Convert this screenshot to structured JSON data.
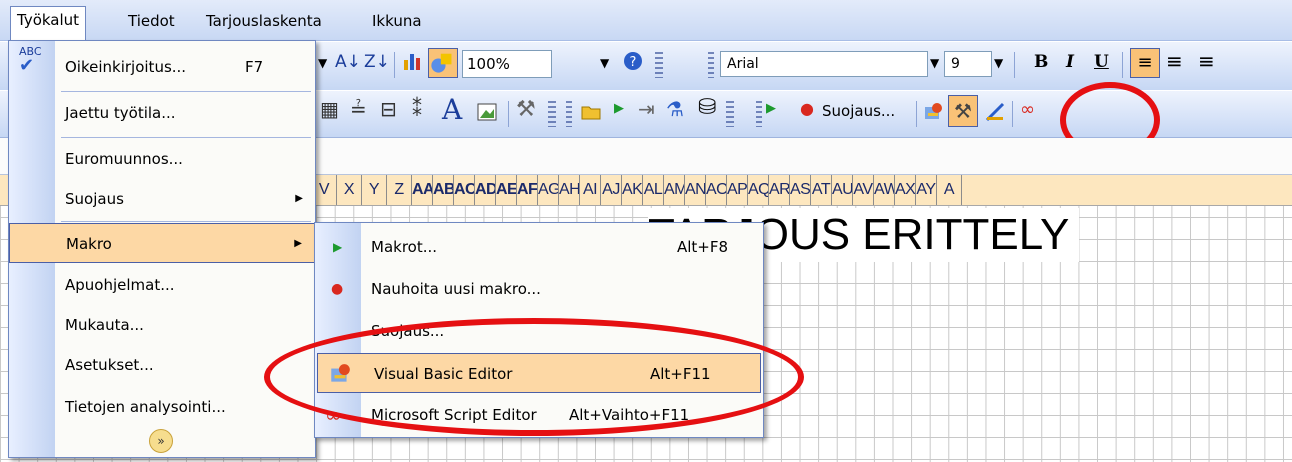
{
  "menubar": {
    "items": [
      {
        "label": "Työkalut"
      },
      {
        "label": "Tiedot"
      },
      {
        "label": "Tarjouslaskenta"
      },
      {
        "label": "Ikkuna"
      }
    ]
  },
  "toolbar_std": {
    "zoom": "100%"
  },
  "toolbar_fmt": {
    "font": "Arial",
    "size": "9"
  },
  "toolbar_vb": {
    "security_label": "Suojaus..."
  },
  "columns": [
    "V",
    "X",
    "Y",
    "Z",
    "AA",
    "AB",
    "AC",
    "AD",
    "AE",
    "AF",
    "AG",
    "AH",
    "AI",
    "AJ",
    "AK",
    "AL",
    "AM",
    "AN",
    "AO",
    "AP",
    "AQ",
    "AR",
    "AS",
    "AT",
    "AU",
    "AV",
    "AW",
    "AX",
    "AY",
    "A"
  ],
  "sheet": {
    "title": "TARJOUS ERITTELY"
  },
  "tools_menu": {
    "items": [
      {
        "label": "Oikeinkirjoitus...",
        "shortcut": "F7"
      },
      {
        "label": "Jaettu työtila..."
      },
      {
        "label": "Euromuunnos..."
      },
      {
        "label": "Suojaus"
      },
      {
        "label": "Makro"
      },
      {
        "label": "Apuohjelmat..."
      },
      {
        "label": "Mukauta..."
      },
      {
        "label": "Asetukset..."
      },
      {
        "label": "Tietojen analysointi..."
      }
    ]
  },
  "macro_menu": {
    "items": [
      {
        "label": "Makrot...",
        "shortcut": "Alt+F8"
      },
      {
        "label": "Nauhoita uusi makro..."
      },
      {
        "label": "Suojaus..."
      },
      {
        "label": "Visual Basic Editor",
        "shortcut": "Alt+F11"
      },
      {
        "label": "Microsoft Script Editor",
        "shortcut": "Alt+Vaihto+F11"
      }
    ]
  },
  "colors": {
    "highlight": "#fdd8a5",
    "annotation": "#e51012",
    "menubar": "#c8d8f4"
  }
}
